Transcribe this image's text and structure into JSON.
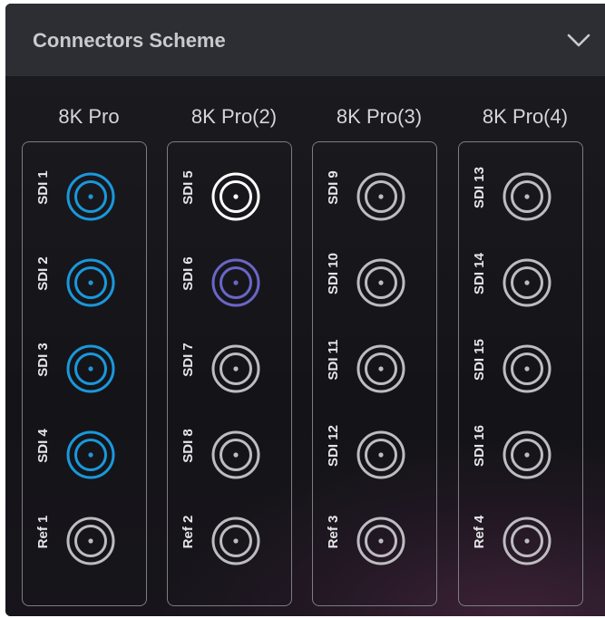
{
  "header": {
    "title": "Connectors Scheme",
    "collapse_icon": "chevron-down-icon"
  },
  "colors": {
    "active": "#1a98dc",
    "selected": "#ffffff",
    "linked": "#6a66c8",
    "idle": "#bdbdc1"
  },
  "groups": [
    {
      "label": "8K Pro",
      "connectors": [
        {
          "label": "SDI 1",
          "state": "active"
        },
        {
          "label": "SDI 2",
          "state": "active"
        },
        {
          "label": "SDI 3",
          "state": "active"
        },
        {
          "label": "SDI 4",
          "state": "active"
        },
        {
          "label": "Ref 1",
          "state": "idle"
        }
      ]
    },
    {
      "label": "8K Pro(2)",
      "connectors": [
        {
          "label": "SDI 5",
          "state": "selected"
        },
        {
          "label": "SDI 6",
          "state": "linked"
        },
        {
          "label": "SDI 7",
          "state": "idle"
        },
        {
          "label": "SDI 8",
          "state": "idle"
        },
        {
          "label": "Ref 2",
          "state": "idle"
        }
      ]
    },
    {
      "label": "8K Pro(3)",
      "connectors": [
        {
          "label": "SDI 9",
          "state": "idle"
        },
        {
          "label": "SDI 10",
          "state": "idle"
        },
        {
          "label": "SDI 11",
          "state": "idle"
        },
        {
          "label": "SDI 12",
          "state": "idle"
        },
        {
          "label": "Ref 3",
          "state": "idle"
        }
      ]
    },
    {
      "label": "8K Pro(4)",
      "connectors": [
        {
          "label": "SDI 13",
          "state": "idle"
        },
        {
          "label": "SDI 14",
          "state": "idle"
        },
        {
          "label": "SDI 15",
          "state": "idle"
        },
        {
          "label": "SDI 16",
          "state": "idle"
        },
        {
          "label": "Ref 4",
          "state": "idle"
        }
      ]
    }
  ]
}
